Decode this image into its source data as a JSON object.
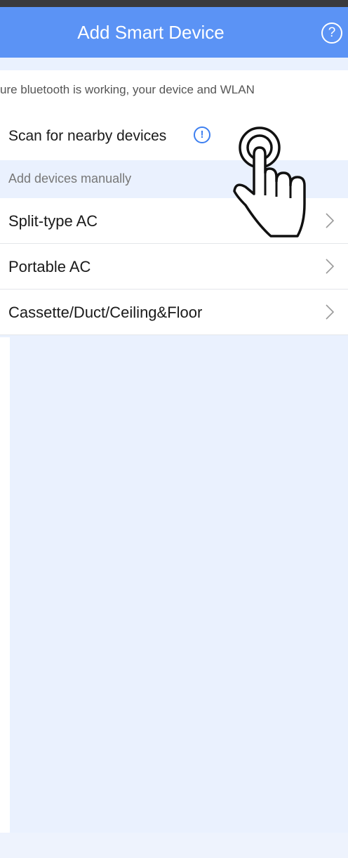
{
  "header": {
    "title": "Add Smart Device",
    "help_icon": "help-circle-icon",
    "background": "#5b93f5"
  },
  "tip": {
    "text": "ure bluetooth is working, your device and WLAN"
  },
  "scan": {
    "label": "Scan for nearby devices",
    "info_icon": "info-circle-icon",
    "info_glyph": "!"
  },
  "manual": {
    "section_label": "Add devices manually",
    "items": [
      {
        "label": "Split-type AC"
      },
      {
        "label": "Portable AC"
      },
      {
        "label": "Cassette/Duct/Ceiling&Floor"
      }
    ]
  },
  "overlay": {
    "gesture_icon": "tap-hand-icon"
  },
  "colors": {
    "accent": "#3d7ff0",
    "page_background": "#eaf1fe"
  }
}
